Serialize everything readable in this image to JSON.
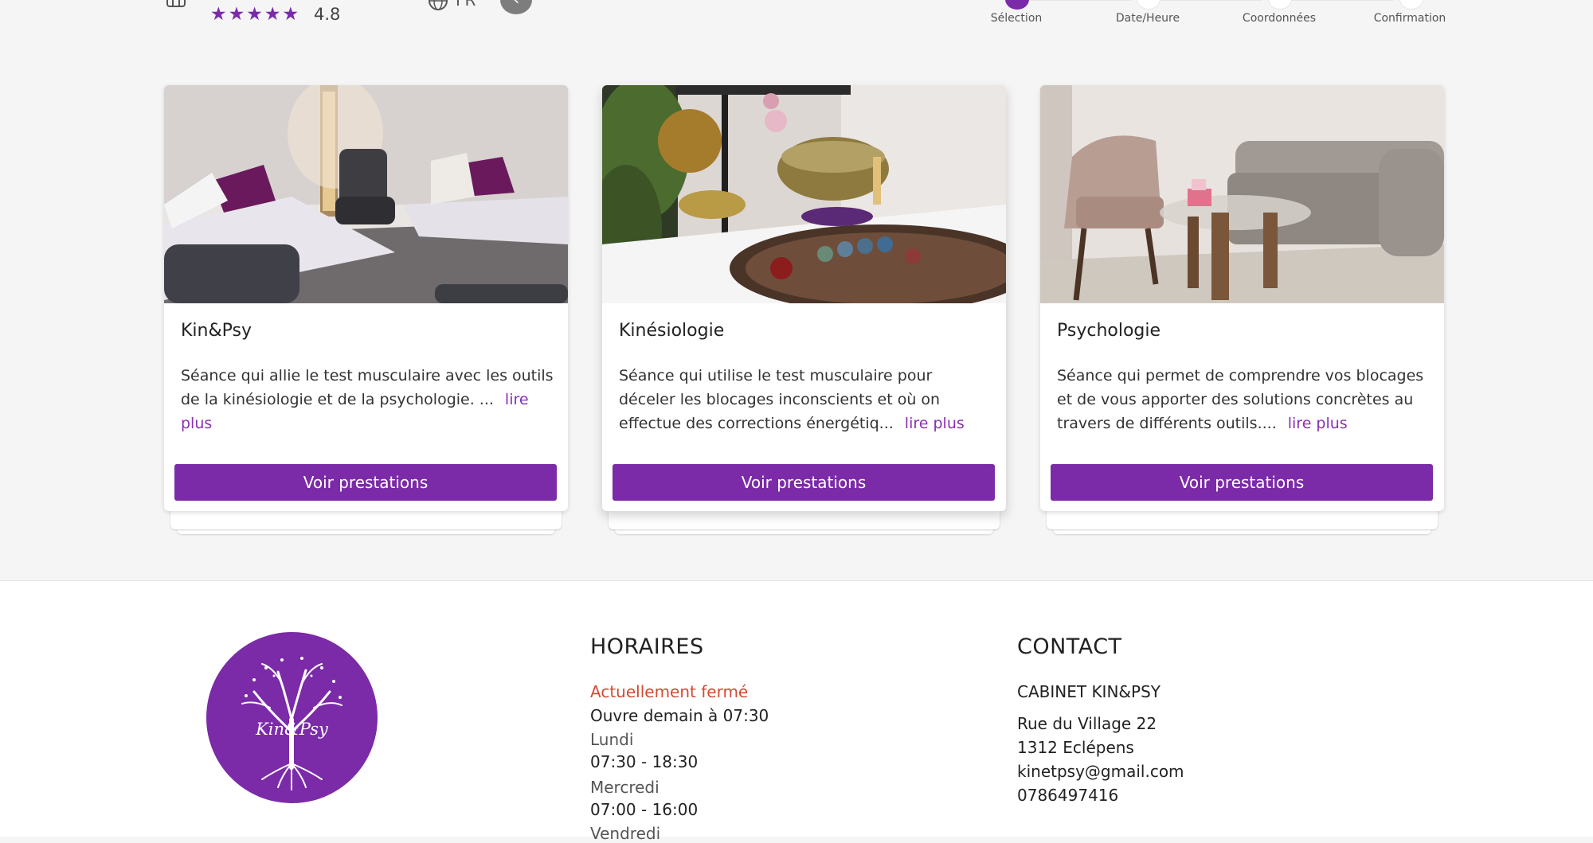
{
  "header": {
    "rating": "4.8",
    "language": "FR",
    "stars": 5,
    "steps": [
      {
        "label": "Sélection",
        "active": true
      },
      {
        "label": "Date/Heure",
        "active": false
      },
      {
        "label": "Coordonnées",
        "active": false
      },
      {
        "label": "Confirmation",
        "active": false
      }
    ]
  },
  "cards": [
    {
      "title": "Kin&Psy",
      "description": "Séance qui allie le test musculaire avec les outils de la kinésiologie et de la psychologie. ...",
      "more": "lire plus",
      "button": "Voir prestations"
    },
    {
      "title": "Kinésiologie",
      "description": "Séance qui utilise le test musculaire pour déceler les blocages inconscients et où on effectue des corrections énergétiq...",
      "more": "lire plus",
      "button": "Voir prestations"
    },
    {
      "title": "Psychologie",
      "description": "Séance qui permet de comprendre vos blocages et de vous apporter des solutions concrètes au travers de différents outils....",
      "more": "lire plus",
      "button": "Voir prestations"
    }
  ],
  "footer": {
    "logo_text": "Kin&Psy",
    "hours": {
      "heading": "HORAIRES",
      "status": "Actuellement fermé",
      "next_open": "Ouvre demain à 07:30",
      "days": [
        {
          "day": "Lundi",
          "time": "07:30 - 18:30"
        },
        {
          "day": "Mercredi",
          "time": "07:00 - 16:00"
        },
        {
          "day": "Vendredi",
          "time": ""
        }
      ]
    },
    "contact": {
      "heading": "CONTACT",
      "name": "CABINET KIN&PSY",
      "street": "Rue du Village 22",
      "city": "1312 Eclépens",
      "email": "kinetpsy@gmail.com",
      "phone": "0786497416"
    }
  },
  "colors": {
    "accent": "#7b2aa8",
    "closed": "#d24b33",
    "background": "#f5f5f5"
  }
}
